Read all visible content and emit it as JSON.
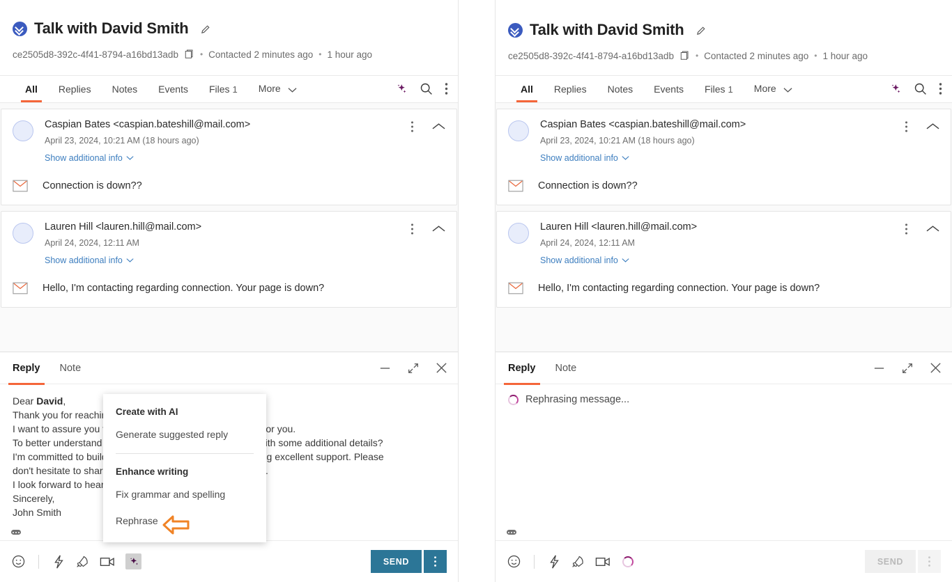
{
  "header": {
    "channel_icon": "double-chevron-down-icon",
    "title": "Talk with David Smith",
    "edit_icon": "pencil-icon",
    "conversation_id": "ce2505d8-392c-4f41-8794-a16bd13adb",
    "copy_icon": "copy-icon",
    "separator": "•",
    "contacted": "Contacted 2 minutes ago",
    "last_activity": "1 hour ago"
  },
  "tabs": {
    "items": [
      {
        "label": "All",
        "badge": "",
        "active": true
      },
      {
        "label": "Replies",
        "badge": "",
        "active": false
      },
      {
        "label": "Notes",
        "badge": "",
        "active": false
      },
      {
        "label": "Events",
        "badge": "",
        "active": false
      },
      {
        "label": "Files",
        "badge": "1",
        "active": false
      },
      {
        "label": "More",
        "badge": "",
        "active": false
      }
    ],
    "more_chevron_icon": "chevron-down-icon",
    "ai_icon": "ai-sparkle-icon",
    "search_icon": "search-icon",
    "overflow_icon": "kebab-menu-icon"
  },
  "messages": [
    {
      "avatar": "avatar-placeholder",
      "from": "Caspian Bates <caspian.bateshill@mail.com>",
      "date": "April 23, 2024, 10:21 AM  (18 hours ago)",
      "show_info": "Show additional info",
      "show_info_chevron": "chevron-down-icon",
      "body_icon": "envelope-icon",
      "body": "Connection is down??",
      "kebab_icon": "kebab-menu-icon",
      "collapse_icon": "chevron-up-icon"
    },
    {
      "avatar": "avatar-placeholder",
      "from": "Lauren Hill <lauren.hill@mail.com>",
      "date": "April 24, 2024, 12:11 AM",
      "show_info": "Show additional info",
      "show_info_chevron": "chevron-down-icon",
      "body_icon": "envelope-icon",
      "body": "Hello, I'm contacting regarding connection. Your page is down?",
      "kebab_icon": "kebab-menu-icon",
      "collapse_icon": "chevron-up-icon"
    }
  ],
  "composer_left": {
    "tabs": [
      {
        "label": "Reply",
        "active": true
      },
      {
        "label": "Note",
        "active": false
      }
    ],
    "minimize_icon": "minimize-icon",
    "expand_icon": "expand-icon",
    "close_icon": "close-icon",
    "draft_lines": [
      "Dear David,",
      "Thank you for reaching out to us about your concerns.",
      "I want to assure you that we will find a solution that works for you.",
      "To better understand the situation, could you provide me with some additional details?",
      "I'm committed to building a strong relationship and providing excellent support. Please",
      "don't hesitate to share any further questions you may have.",
      "I look forward to hearing from you soon.",
      "Sincerely,",
      "John Smith"
    ],
    "draft_bold_word": "David",
    "resize_grip": "resize-grip-handle",
    "toolbar": {
      "emoji_icon": "emoji-icon",
      "shortcut_icon": "lightning-bolt-icon",
      "boost_icon": "rocket-icon",
      "video_icon": "video-camera-icon",
      "ai_icon": "ai-sparkle-icon"
    },
    "send_label": "SEND",
    "send_caret_icon": "kebab-menu-icon",
    "send_enabled": true
  },
  "composer_right": {
    "tabs": [
      {
        "label": "Reply",
        "active": true
      },
      {
        "label": "Note",
        "active": false
      }
    ],
    "minimize_icon": "minimize-icon",
    "expand_icon": "expand-icon",
    "close_icon": "close-icon",
    "loading_text": "Rephrasing message...",
    "loading_spinner": "spinner-icon",
    "resize_grip": "resize-grip-handle",
    "toolbar": {
      "emoji_icon": "emoji-icon",
      "shortcut_icon": "lightning-bolt-icon",
      "boost_icon": "rocket-icon",
      "video_icon": "video-camera-icon",
      "ai_icon": "spinner-icon"
    },
    "send_label": "SEND",
    "send_caret_icon": "kebab-menu-icon",
    "send_enabled": false
  },
  "ai_menu": {
    "section1_title": "Create with AI",
    "item_generate": "Generate suggested reply",
    "section2_title": "Enhance writing",
    "item_fix": "Fix grammar and spelling",
    "item_rephrase": "Rephrase"
  },
  "annotation": {
    "arrow_icon": "left-arrow-callout",
    "arrow_color": "#F08326"
  },
  "colors": {
    "accent_orange": "#F4663A",
    "send_blue": "#2C7697",
    "link_blue": "#3D7EBF",
    "channel_blue": "#3B5BBF",
    "ai_purple": "#6B1A63"
  }
}
